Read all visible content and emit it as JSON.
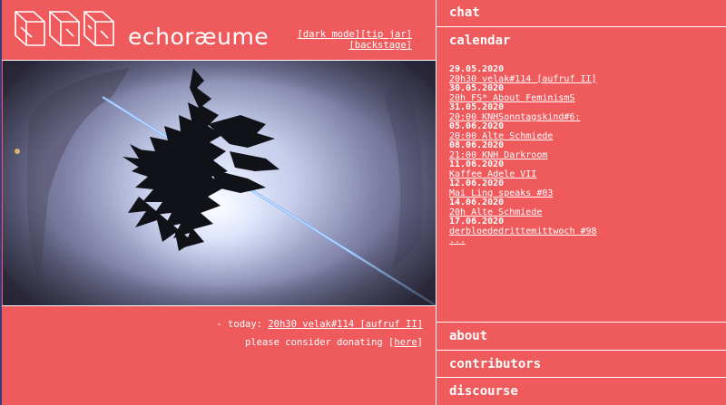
{
  "header": {
    "title": "echoræume",
    "links": {
      "dark_mode": "[dark mode]",
      "tip_jar": "[tip jar]",
      "backstage": "[backstage]"
    }
  },
  "footer": {
    "today_prefix": "- today:",
    "today_event": "20h30 velak#114 [aufruf II]",
    "donate_text": "please consider donating [",
    "donate_link": "here",
    "donate_close": "]"
  },
  "panel": {
    "chat": "chat",
    "calendar": "calendar",
    "about": "about",
    "contributors": "contributors",
    "discourse": "discourse"
  },
  "calendar": [
    {
      "date": "29.05.2020",
      "event": "20h30 velak#114 [aufruf II]"
    },
    {
      "date": "30.05.2020",
      "event": "20h FS* About FeminismS"
    },
    {
      "date": "31.05.2020",
      "event": "20:00 KNHSonntagskind#6:"
    },
    {
      "date": "05.06.2020",
      "event": "20:00 Alte Schmiede"
    },
    {
      "date": "08.06.2020",
      "event": "21:00 KNH Darkroom"
    },
    {
      "date": "11.06.2020",
      "event": "Kaffee Adele VII"
    },
    {
      "date": "12.06.2020",
      "event": "Mai Ling speaks #03"
    },
    {
      "date": "14.06.2020",
      "event": "20h Alte Schmiede"
    },
    {
      "date": "17.06.2020",
      "event": "derbloededrittemittwoch #98"
    }
  ],
  "calendar_more": "...",
  "colors": {
    "background": "#ef5a5c",
    "text": "#ffffff",
    "edge": "#3b3b7a"
  }
}
